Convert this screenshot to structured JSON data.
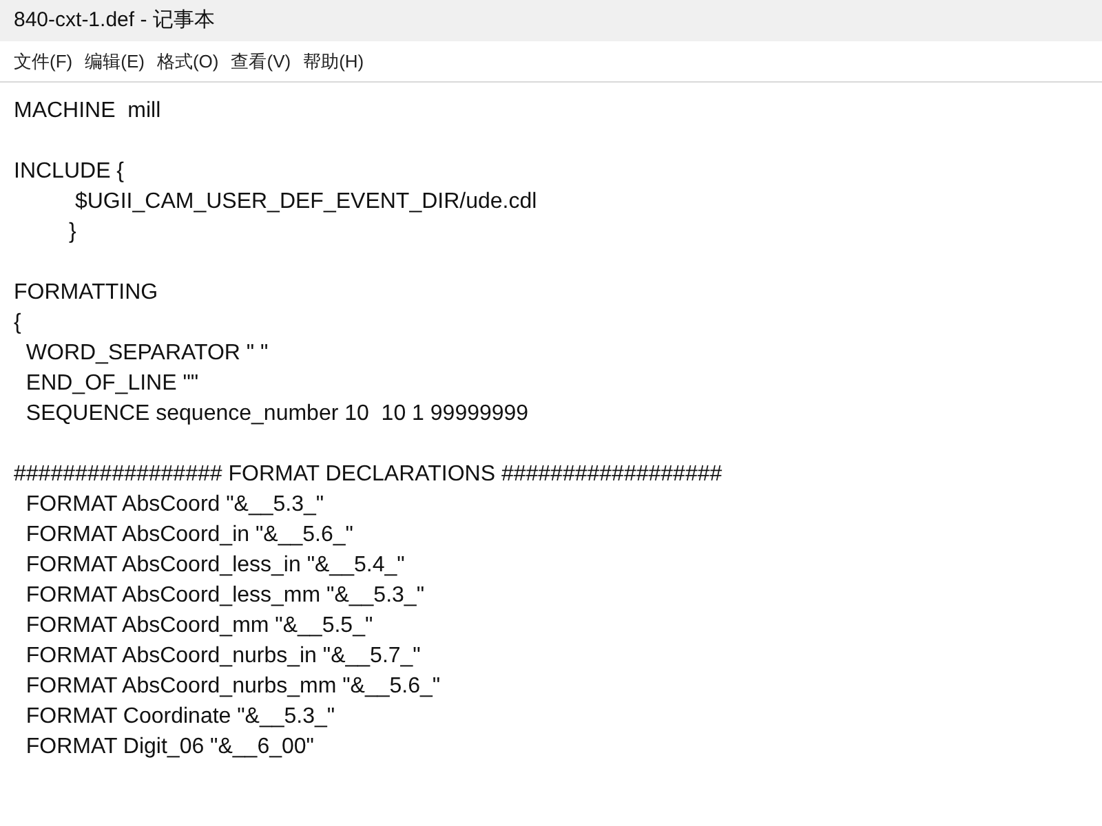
{
  "window": {
    "title": "840-cxt-1.def - 记事本"
  },
  "menu": [
    "文件(F)",
    "编辑(E)",
    "格式(O)",
    "查看(V)",
    "帮助(H)"
  ],
  "editor": {
    "blocks": [
      [
        "MACHINE  mill"
      ],
      [
        "INCLUDE {",
        "          $UGII_CAM_USER_DEF_EVENT_DIR/ude.cdl",
        "         }"
      ],
      [
        "FORMATTING",
        "{",
        "  WORD_SEPARATOR \" \"",
        "  END_OF_LINE \"\"",
        "  SEQUENCE sequence_number 10  10 1 99999999"
      ],
      [
        "################# FORMAT DECLARATIONS ##################",
        "  FORMAT AbsCoord \"&__5.3_\"",
        "  FORMAT AbsCoord_in \"&__5.6_\"",
        "  FORMAT AbsCoord_less_in \"&__5.4_\"",
        "  FORMAT AbsCoord_less_mm \"&__5.3_\"",
        "  FORMAT AbsCoord_mm \"&__5.5_\"",
        "  FORMAT AbsCoord_nurbs_in \"&__5.7_\"",
        "  FORMAT AbsCoord_nurbs_mm \"&__5.6_\"",
        "  FORMAT Coordinate \"&__5.3_\"",
        "  FORMAT Digit_06 \"&__6_00\""
      ]
    ]
  }
}
